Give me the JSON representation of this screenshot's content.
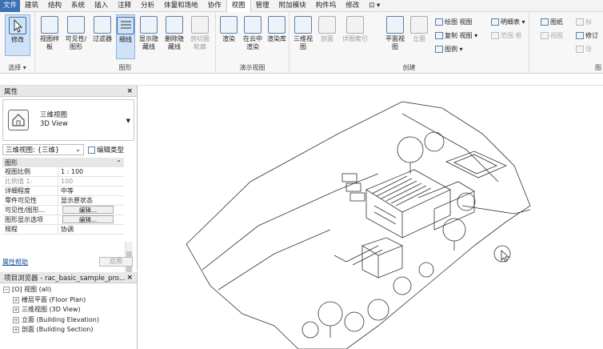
{
  "menu": {
    "items": [
      "文件",
      "建筑",
      "结构",
      "系统",
      "插入",
      "注释",
      "分析",
      "体量和场地",
      "协作",
      "视图",
      "管理",
      "附加模块",
      "构件坞",
      "修改",
      "⊡ ▾"
    ],
    "active_index": 9
  },
  "ribbon": {
    "select": {
      "modify_label": "修改",
      "group_label": "选择 ▾"
    },
    "graphics": {
      "group_label": "图形",
      "tools": [
        "视图样板",
        "可见性/图形",
        "过滤器",
        "细线",
        "显示隐藏线",
        "删除隐藏线",
        "剖切面轮廓"
      ]
    },
    "presentation": {
      "group_label": "演示视图",
      "tools": [
        "渲染",
        "在云中渲染",
        "渲染库"
      ]
    },
    "create": {
      "group_label": "创建",
      "tools": [
        "三维视图",
        "剖面",
        "详图索引",
        "平面视图",
        "立面"
      ],
      "small": [
        "绘图 视图",
        "复制 视图 ▾",
        "图例 ▾",
        "明细表 ▾",
        "范围 框"
      ]
    },
    "sheet": {
      "small": [
        "图纸",
        "标",
        "视图",
        "修订",
        "导"
      ]
    },
    "extra": "图"
  },
  "properties": {
    "title": "属性",
    "close": "×",
    "type_name_cn": "三维视图",
    "type_name_en": "3D View",
    "view_selector": "三维视图: {三维}",
    "edit_type": "编辑类型",
    "section": "图形",
    "rows": [
      {
        "k": "视图比例",
        "v": "1 : 100",
        "dim": false
      },
      {
        "k": "比例值 1:",
        "v": "100",
        "dim": true
      },
      {
        "k": "详细程度",
        "v": "中等",
        "dim": false
      },
      {
        "k": "零件可见性",
        "v": "显示原状态",
        "dim": false
      },
      {
        "k": "可见性/图形...",
        "v": "编辑...",
        "btn": true
      },
      {
        "k": "图形显示选项",
        "v": "编辑...",
        "btn": true
      },
      {
        "k": "规程",
        "v": "协调",
        "dim": false
      }
    ],
    "help": "属性帮助",
    "apply": "应用"
  },
  "browser": {
    "title": "项目浏览器 - rac_basic_sample_pro...",
    "close": "×",
    "root": "[O] 视图 (all)",
    "items": [
      "楼层平面 (Floor Plan)",
      "三维视图 (3D View)",
      "立面 (Building Elevation)",
      "剖面 (Building Section)"
    ]
  }
}
